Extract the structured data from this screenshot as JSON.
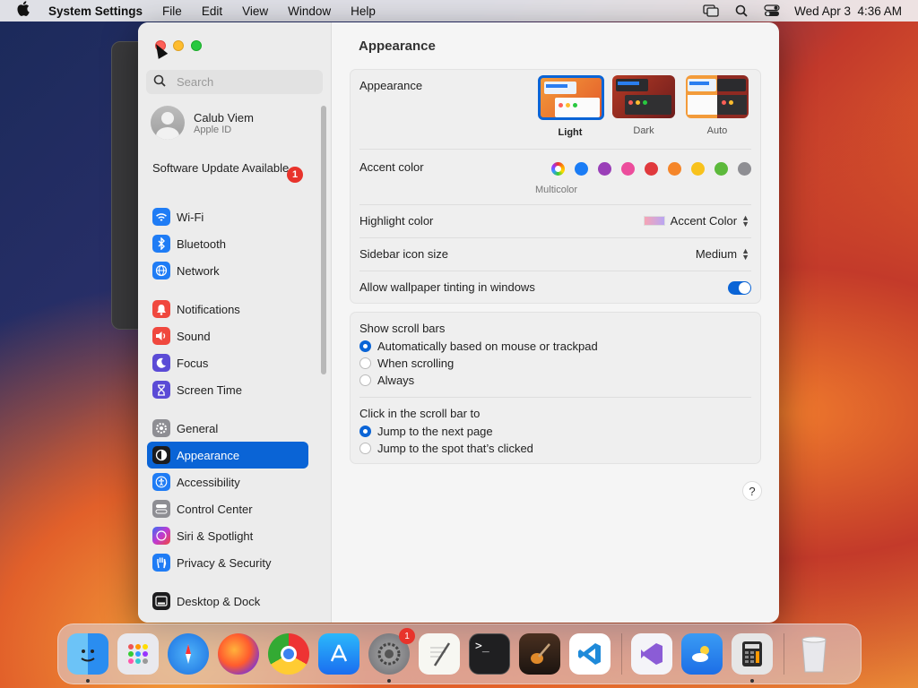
{
  "menubar": {
    "app_name": "System Settings",
    "items": [
      "File",
      "Edit",
      "View",
      "Window",
      "Help"
    ],
    "datetime": "Wed Apr 3  4:36 AM"
  },
  "sidebar": {
    "search_placeholder": "Search",
    "account": {
      "name": "Calub Viem",
      "subtitle": "Apple ID"
    },
    "update": {
      "label": "Software Update Available",
      "badge": "1"
    },
    "groups": [
      [
        {
          "label": "Wi-Fi",
          "icon": "wifi-icon",
          "color": "#1f7cf5"
        },
        {
          "label": "Bluetooth",
          "icon": "bluetooth-icon",
          "color": "#1f7cf5"
        },
        {
          "label": "Network",
          "icon": "globe-icon",
          "color": "#1f7cf5"
        }
      ],
      [
        {
          "label": "Notifications",
          "icon": "bell-icon",
          "color": "#f0483e"
        },
        {
          "label": "Sound",
          "icon": "speaker-icon",
          "color": "#f0483e"
        },
        {
          "label": "Focus",
          "icon": "moon-icon",
          "color": "#5b4bd6"
        },
        {
          "label": "Screen Time",
          "icon": "hourglass-icon",
          "color": "#5b4bd6"
        }
      ],
      [
        {
          "label": "General",
          "icon": "gear-icon",
          "color": "#8e8e93"
        },
        {
          "label": "Appearance",
          "icon": "appearance-icon",
          "color": "#1c1c1e",
          "active": true
        },
        {
          "label": "Accessibility",
          "icon": "accessibility-icon",
          "color": "#1f7cf5"
        },
        {
          "label": "Control Center",
          "icon": "toggles-icon",
          "color": "#8e8e93"
        },
        {
          "label": "Siri & Spotlight",
          "icon": "siri-icon",
          "color": "#c03ad0"
        },
        {
          "label": "Privacy & Security",
          "icon": "hand-icon",
          "color": "#1f7cf5"
        }
      ],
      [
        {
          "label": "Desktop & Dock",
          "icon": "dock-icon",
          "color": "#1c1c1e"
        }
      ]
    ]
  },
  "content": {
    "title": "Appearance",
    "appearance": {
      "label": "Appearance",
      "options": [
        {
          "label": "Light",
          "selected": true
        },
        {
          "label": "Dark",
          "selected": false
        },
        {
          "label": "Auto",
          "selected": false
        }
      ]
    },
    "accent": {
      "label": "Accent color",
      "selected_label": "Multicolor",
      "colors": [
        "multicolor",
        "#1a7cf5",
        "#9a3fb8",
        "#ec4d9c",
        "#e0393d",
        "#f5862a",
        "#f8c21c",
        "#5cb93b",
        "#8e8e93"
      ]
    },
    "highlight": {
      "label": "Highlight color",
      "value": "Accent Color"
    },
    "icon_size": {
      "label": "Sidebar icon size",
      "value": "Medium"
    },
    "tinting": {
      "label": "Allow wallpaper tinting in windows",
      "on": true
    },
    "scrollbars": {
      "label": "Show scroll bars",
      "options": [
        {
          "label": "Automatically based on mouse or trackpad",
          "selected": true
        },
        {
          "label": "When scrolling",
          "selected": false
        },
        {
          "label": "Always",
          "selected": false
        }
      ]
    },
    "click_scroll": {
      "label": "Click in the scroll bar to",
      "options": [
        {
          "label": "Jump to the next page",
          "selected": true
        },
        {
          "label": "Jump to the spot that’s clicked",
          "selected": false
        }
      ]
    },
    "help_label": "?"
  },
  "dock": {
    "apps": [
      {
        "name": "finder-icon",
        "color": "#2a8df0",
        "glyph": "☺"
      },
      {
        "name": "launchpad-icon",
        "color": "#e9e9ee",
        "glyph": "▦"
      },
      {
        "name": "safari-icon",
        "color": "#2f8ef0",
        "glyph": "✦"
      },
      {
        "name": "firefox-icon",
        "color": "#7a36d6",
        "glyph": "◉"
      },
      {
        "name": "chrome-icon",
        "color": "#f2f2f2",
        "glyph": "◎"
      },
      {
        "name": "app-store-icon",
        "color": "#1b8cf4",
        "glyph": "A"
      },
      {
        "name": "system-settings-icon",
        "color": "#8a8a90",
        "glyph": "⚙",
        "badge": "1"
      },
      {
        "name": "textedit-icon",
        "color": "#f7f7f2",
        "glyph": "✎"
      },
      {
        "name": "terminal-icon",
        "color": "#202022",
        "glyph": ">_"
      },
      {
        "name": "garageband-icon",
        "color": "#2d2d2d",
        "glyph": "♪"
      },
      {
        "name": "vscode-icon",
        "color": "#ffffff",
        "glyph": "❯"
      },
      {
        "name": "visual-studio-icon",
        "color": "#f4f4f8",
        "glyph": "∞"
      },
      {
        "name": "weather-icon",
        "color": "#2f8ef0",
        "glyph": "☁"
      },
      {
        "name": "calculator-icon",
        "color": "#e6e6e6",
        "glyph": "▤"
      },
      {
        "name": "trash-icon",
        "color": "#d8d8dc",
        "glyph": "🗑"
      }
    ]
  }
}
